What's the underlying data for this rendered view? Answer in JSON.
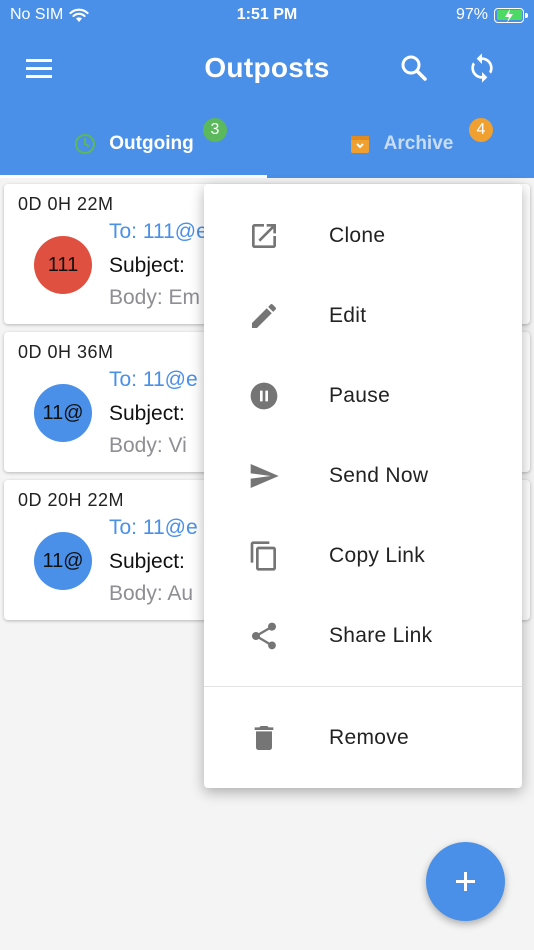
{
  "status_bar": {
    "carrier": "No SIM",
    "time": "1:51 PM",
    "battery": "97%"
  },
  "app_bar": {
    "title": "Outposts",
    "background_color": "#4a90e8"
  },
  "tabs": [
    {
      "label": "Outgoing",
      "badge": "3",
      "icon": "clock-icon",
      "selected": true
    },
    {
      "label": "Archive",
      "badge": "4",
      "icon": "archive-box-icon",
      "selected": false
    }
  ],
  "cards": [
    {
      "countdown": "0D 0H 22M",
      "avatar": "111",
      "avatar_color": "#e05040",
      "to": "To: 111@e",
      "subject": "Subject:",
      "body": "Body: Em"
    },
    {
      "countdown": "0D 0H 36M",
      "avatar": "11@",
      "avatar_color": "#4a90e8",
      "to": "To: 11@e",
      "subject": "Subject:",
      "body": "Body: Vi"
    },
    {
      "countdown": "0D 20H 22M",
      "avatar": "11@",
      "avatar_color": "#4a90e8",
      "to": "To: 11@e",
      "subject": "Subject:",
      "body": "Body: Au"
    }
  ],
  "context_menu": {
    "items": [
      {
        "label": "Clone",
        "icon": "open-in-new-icon"
      },
      {
        "label": "Edit",
        "icon": "pencil-icon"
      },
      {
        "label": "Pause",
        "icon": "pause-circle-icon"
      },
      {
        "label": "Send Now",
        "icon": "send-icon"
      },
      {
        "label": "Copy Link",
        "icon": "copy-icon"
      },
      {
        "label": "Share Link",
        "icon": "share-icon"
      },
      {
        "label": "Remove",
        "icon": "trash-icon"
      }
    ]
  },
  "fab": {
    "icon": "plus-icon"
  }
}
